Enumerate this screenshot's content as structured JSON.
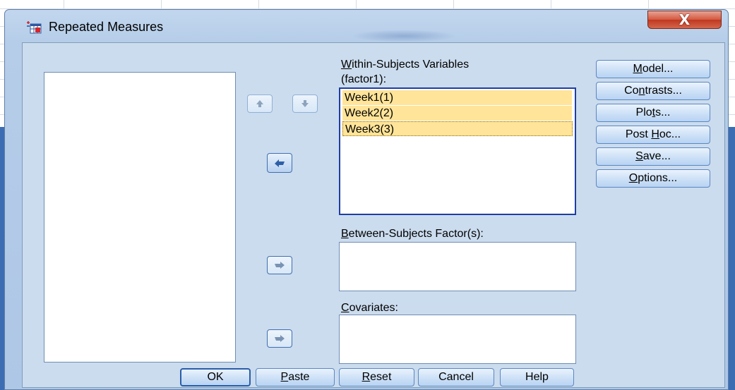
{
  "window": {
    "title": "Repeated Measures",
    "close_label": "X",
    "icon": "repeated-measures-app-icon"
  },
  "within": {
    "label_first": "W",
    "label_rest": "ithin-Subjects Variables",
    "sublabel": "(factor1):",
    "items": [
      "Week1(1)",
      "Week2(2)",
      "Week3(3)"
    ]
  },
  "between": {
    "label_first": "B",
    "label_rest": "etween-Subjects Factor(s):"
  },
  "covariates": {
    "label_first": "C",
    "label_rest": "ovariates:"
  },
  "side_buttons": {
    "model": {
      "pre": "",
      "u": "M",
      "post": "odel..."
    },
    "contrasts": {
      "pre": "Co",
      "u": "n",
      "post": "trasts..."
    },
    "plots": {
      "pre": "Plo",
      "u": "t",
      "post": "s..."
    },
    "posthoc": {
      "pre": "Post ",
      "u": "H",
      "post": "oc..."
    },
    "save": {
      "pre": "",
      "u": "S",
      "post": "ave..."
    },
    "options": {
      "pre": "",
      "u": "O",
      "post": "ptions..."
    }
  },
  "bottom_buttons": {
    "ok": {
      "pre": "OK",
      "u": "",
      "post": ""
    },
    "paste": {
      "pre": "",
      "u": "P",
      "post": "aste"
    },
    "reset": {
      "pre": "",
      "u": "R",
      "post": "eset"
    },
    "cancel": {
      "pre": "Cancel",
      "u": "",
      "post": ""
    },
    "help": {
      "pre": "Help",
      "u": "",
      "post": ""
    }
  },
  "arrow_icons": {
    "up": "move-up-icon",
    "down": "move-down-icon",
    "move_left": "move-left-icon",
    "move_right_between": "move-right-icon",
    "move_right_covariates": "move-right-icon"
  },
  "colors": {
    "selection": "#ffe499",
    "client_bg": "#cbdcee",
    "button_border": "#5b87c2",
    "close_red": "#c03820"
  }
}
